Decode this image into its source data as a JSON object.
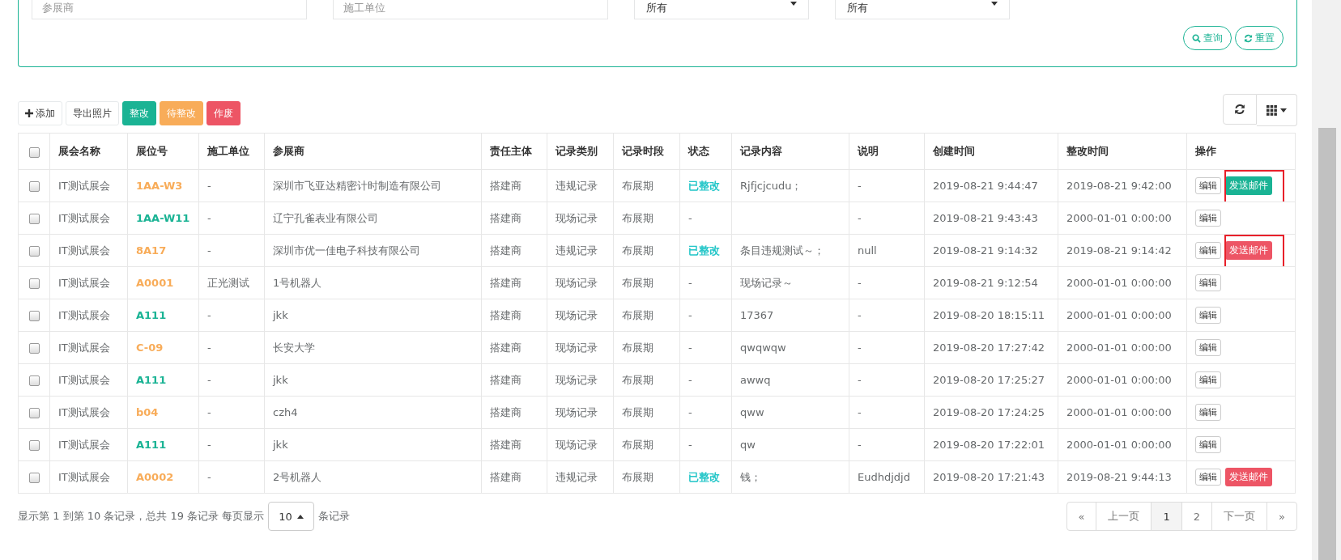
{
  "filter": {
    "fields": [
      {
        "placeholder": "参展商"
      },
      {
        "placeholder": "施工单位"
      }
    ],
    "selects": [
      {
        "value": "所有"
      },
      {
        "value": "所有"
      }
    ],
    "buttons": [
      {
        "label": "查询",
        "kind": "search"
      },
      {
        "label": "重置",
        "kind": "reset"
      }
    ]
  },
  "toolbar": {
    "buttons": [
      {
        "label": "添加",
        "kind": "add"
      },
      {
        "label": "导出照片",
        "kind": "plain"
      },
      {
        "label": "整改",
        "kind": "primary"
      },
      {
        "label": "待整改",
        "kind": "warning"
      },
      {
        "label": "作废",
        "kind": "danger"
      }
    ]
  },
  "table": {
    "header_checked": false,
    "columns": [
      "展会名称",
      "展位号",
      "施工单位",
      "参展商",
      "责任主体",
      "记录类别",
      "记录时段",
      "状态",
      "记录内容",
      "说明",
      "创建时间",
      "整改时间",
      "操作"
    ],
    "rows": [
      {
        "checked": false,
        "cells": [
          "IT测试展会",
          "1AA-W3",
          "-",
          "深圳市飞亚达精密计时制造有限公司",
          "搭建商",
          "违规记录",
          "布展期",
          "已整改",
          "Rjfjcjcudu；",
          "-",
          "2019-08-21 9:44:47",
          "2019-08-21 9:42:00"
        ],
        "color": "#f8ac59",
        "status_done": true,
        "edit": "编辑",
        "email": {
          "label": "发送邮件",
          "color": "#1ab394",
          "highlighted": true
        }
      },
      {
        "checked": false,
        "cells": [
          "IT测试展会",
          "1AA-W11",
          "-",
          "辽宁孔雀表业有限公司",
          "搭建商",
          "现场记录",
          "布展期",
          "-",
          "",
          "-",
          "2019-08-21 9:43:43",
          "2000-01-01 0:00:00"
        ],
        "color": "#1ab394",
        "status_done": false,
        "edit": "编辑"
      },
      {
        "checked": false,
        "cells": [
          "IT测试展会",
          "8A17",
          "-",
          "深圳市优一佳电子科技有限公司",
          "搭建商",
          "违规记录",
          "布展期",
          "已整改",
          "条目违规测试～；",
          "null",
          "2019-08-21 9:14:32",
          "2019-08-21 9:14:42"
        ],
        "color": "#f8ac59",
        "status_done": true,
        "edit": "编辑",
        "email": {
          "label": "发送邮件",
          "color": "#ed5565",
          "highlighted": true
        }
      },
      {
        "checked": false,
        "cells": [
          "IT测试展会",
          "A0001",
          "正光测试",
          "1号机器人",
          "搭建商",
          "现场记录",
          "布展期",
          "-",
          "现场记录～",
          "-",
          "2019-08-21 9:12:54",
          "2000-01-01 0:00:00"
        ],
        "color": "#f8ac59",
        "status_done": false,
        "edit": "编辑"
      },
      {
        "checked": false,
        "cells": [
          "IT测试展会",
          "A111",
          "-",
          "jkk",
          "搭建商",
          "现场记录",
          "布展期",
          "-",
          "17367",
          "-",
          "2019-08-20 18:15:11",
          "2000-01-01 0:00:00"
        ],
        "color": "#1ab394",
        "status_done": false,
        "edit": "编辑"
      },
      {
        "checked": false,
        "cells": [
          "IT测试展会",
          "C-09",
          "-",
          "长安大学",
          "搭建商",
          "现场记录",
          "布展期",
          "-",
          "qwqwqw",
          "-",
          "2019-08-20 17:27:42",
          "2000-01-01 0:00:00"
        ],
        "color": "#f8ac59",
        "status_done": false,
        "edit": "编辑"
      },
      {
        "checked": false,
        "cells": [
          "IT测试展会",
          "A111",
          "-",
          "jkk",
          "搭建商",
          "现场记录",
          "布展期",
          "-",
          "awwq",
          "-",
          "2019-08-20 17:25:27",
          "2000-01-01 0:00:00"
        ],
        "color": "#1ab394",
        "status_done": false,
        "edit": "编辑"
      },
      {
        "checked": false,
        "cells": [
          "IT测试展会",
          "b04",
          "-",
          "czh4",
          "搭建商",
          "现场记录",
          "布展期",
          "-",
          "qww",
          "-",
          "2019-08-20 17:24:25",
          "2000-01-01 0:00:00"
        ],
        "color": "#f8ac59",
        "status_done": false,
        "edit": "编辑"
      },
      {
        "checked": false,
        "cells": [
          "IT测试展会",
          "A111",
          "-",
          "jkk",
          "搭建商",
          "现场记录",
          "布展期",
          "-",
          "qw",
          "-",
          "2019-08-20 17:22:01",
          "2000-01-01 0:00:00"
        ],
        "color": "#1ab394",
        "status_done": false,
        "edit": "编辑"
      },
      {
        "checked": false,
        "cells": [
          "IT测试展会",
          "A0002",
          "-",
          "2号机器人",
          "搭建商",
          "违规记录",
          "布展期",
          "已整改",
          "钱；",
          "Eudhdjdjd",
          "2019-08-20 17:21:43",
          "2019-08-21 9:44:13"
        ],
        "color": "#f8ac59",
        "status_done": true,
        "edit": "编辑",
        "email": {
          "label": "发送邮件",
          "color": "#ed5565",
          "highlighted": false
        }
      }
    ]
  },
  "pagination": {
    "summary": "显示第 1 到第 10 条记录，总共 19 条记录 每页显示",
    "page_size": "10",
    "suffix": "条记录",
    "pages": [
      {
        "label": "«",
        "selected": false
      },
      {
        "label": "上一页",
        "selected": false
      },
      {
        "label": "1",
        "selected": true
      },
      {
        "label": "2",
        "selected": false
      },
      {
        "label": "下一页",
        "selected": false
      },
      {
        "label": "»",
        "selected": false
      }
    ]
  }
}
